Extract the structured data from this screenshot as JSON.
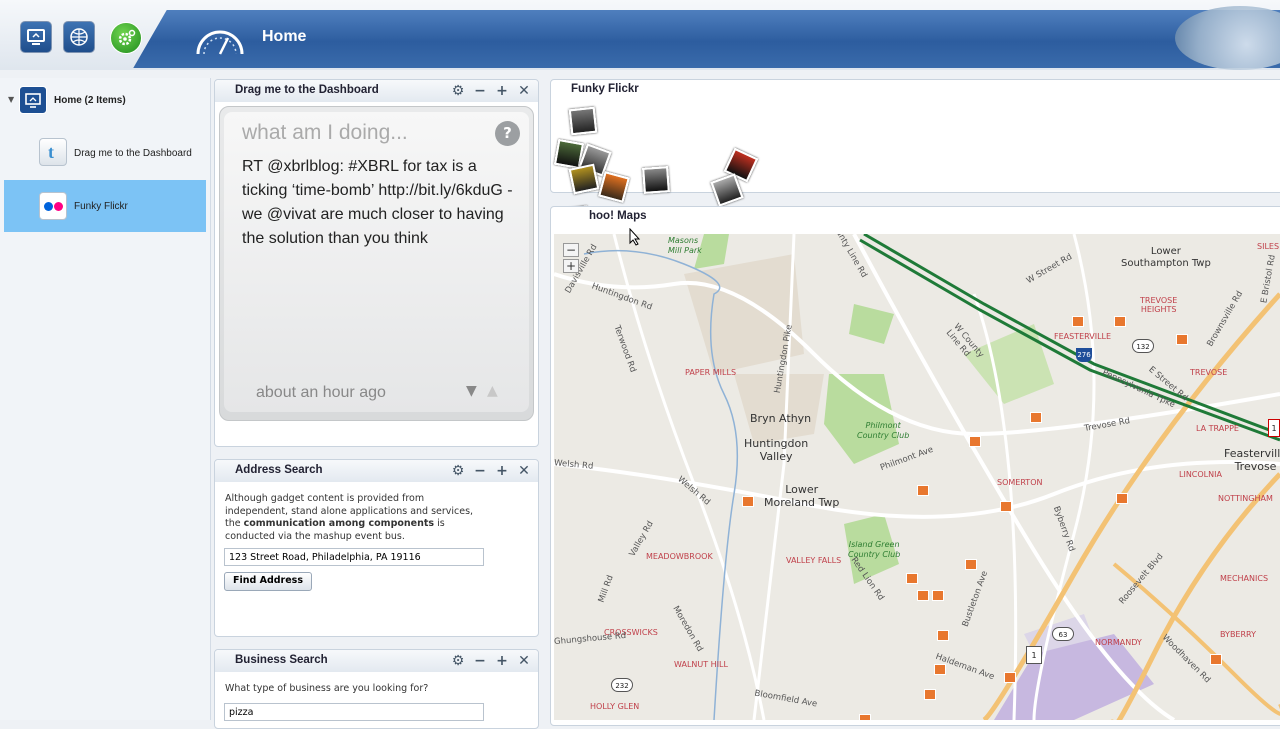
{
  "header": {
    "title": "Home",
    "buttons": [
      {
        "icon": "monitor-icon"
      },
      {
        "icon": "network-icon"
      },
      {
        "icon": "gear-icon"
      }
    ],
    "dashboard_icon": "speedometer-icon"
  },
  "sidebar": {
    "root_label": "Home (2 Items)",
    "items": [
      {
        "label": "Drag me to the Dashboard",
        "icon": "twitter-icon",
        "selected": false
      },
      {
        "label": "Funky Flickr",
        "icon": "flickr-icon",
        "selected": true
      }
    ]
  },
  "twitter_panel": {
    "title": "Drag me to the Dashboard",
    "header": "what am I doing...",
    "tweet": "RT @xbrlblog: #XBRL for tax is a ticking ‘time-bomb’ http://bit.ly/6kduG - we @vivat are much closer to having the solution than you think",
    "time": "about an hour ago",
    "help": "?"
  },
  "address_panel": {
    "title": "Address Search",
    "desc_part1": "Although gadget content is provided from independent, stand alone applications and services, the",
    "desc_bold": "communication among components",
    "desc_part2": "is conducted via the mashup event bus.",
    "address_value": "123 Street Road, Philadelphia, PA 19116",
    "button": "Find Address"
  },
  "business_panel": {
    "title": "Business Search",
    "question": "What type of business are you looking for?",
    "value": "pizza"
  },
  "flickr_panel": {
    "title": "Funky Flickr"
  },
  "maps_panel": {
    "title": "hoo! Maps",
    "zoom_out": "−",
    "zoom_in": "+",
    "labels": {
      "lower_southampton": "Lower\nSouthampton Twp",
      "bryn_athyn": "Bryn Athyn",
      "huntingdon_valley": "Huntingdon\nValley",
      "lower_moreland": "Lower\nMoreland Twp",
      "feasterville": "Feasterville\nTrevose",
      "trevose_heights": "TREVOSE\nHEIGHTS",
      "feasterville_small": "FEASTERVILLE",
      "trevose": "TREVOSE",
      "paper_mills": "PAPER MILLS",
      "philmont": "Philmont\nCountry Club",
      "masons": "Masons\nMill Park",
      "somerton": "SOMERTON",
      "lincolnia": "LINCOLNIA",
      "la_trappe": "LA TRAPPE",
      "nottingham": "NOTTINGHAM",
      "meadowbrook": "MEADOWBROOK",
      "valley_falls": "VALLEY FALLS",
      "island_green": "Island Green\nCountry Club",
      "crosswicks": "CROSSWICKS",
      "walnut_hill": "WALNUT HILL",
      "holly_glen": "HOLLY GLEN",
      "normandy": "NORMANDY",
      "mechanics": "MECHANICS",
      "byberry": "BYBERRY",
      "silesia": "SILES"
    },
    "roads": {
      "county_line": "County Line Rd",
      "w_street": "W Street Rd",
      "huntingdon": "Huntingdon Rd",
      "terwood": "Terwood Rd",
      "huntingdon_pike": "Huntingdon Pike",
      "philmont_ave": "Philmont Ave",
      "welsh": "Welsh Rd",
      "red_lion": "Red Lion Rd",
      "bustleton": "Bustleton Ave",
      "byberry_rd": "Byberry Rd",
      "roosevelt": "Roosevelt Blvd",
      "woodhaven": "Woodhaven Rd",
      "haldeman": "Haldeman Ave",
      "bloomfield": "Bloomfield Ave",
      "moredon": "Moredon Rd",
      "valley": "Valley Rd",
      "mill": "Mill Rd",
      "trevose_rd": "Trevose Rd",
      "brownsville": "Brownsville Rd",
      "e_street": "E Street Rd",
      "davisville": "Davisville Rd",
      "rhawn": "Ghungshouse Rd",
      "w_county": "W County\nLine Rd",
      "e_bristol": "E Bristol Rd",
      "pa_turnpike": "Pennsylvania Tpke",
      "shields": [
        "276",
        "132",
        "1",
        "63",
        "232",
        "1"
      ]
    }
  },
  "colors": {
    "header_blue": "#2d5d9f",
    "selected_row": "#7cc3f5",
    "pin": "#e8772e",
    "park": "#b9dc9e"
  }
}
